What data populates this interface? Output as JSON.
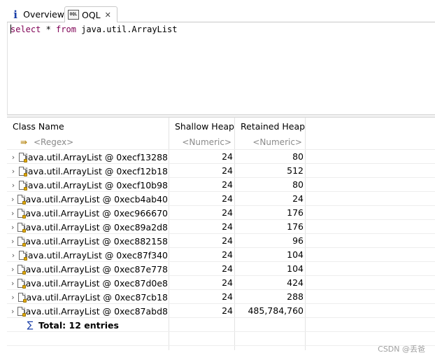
{
  "tabs": [
    {
      "label": "Overview",
      "icon": "info-icon"
    },
    {
      "label": "OQL",
      "icon": "oql-icon",
      "active": true
    }
  ],
  "editor": {
    "keyword_select": "select",
    "mid1": " * ",
    "keyword_from": "from",
    "mid2": " java.util.ArrayList"
  },
  "table": {
    "columns": [
      "Class Name",
      "Shallow Heap",
      "Retained Heap"
    ],
    "filters": [
      "<Regex>",
      "<Numeric>",
      "<Numeric>"
    ],
    "rows": [
      {
        "name": "java.util.ArrayList @ 0xecf13288",
        "shallow": "24",
        "retained": "80"
      },
      {
        "name": "java.util.ArrayList @ 0xecf12b18",
        "shallow": "24",
        "retained": "512"
      },
      {
        "name": "java.util.ArrayList @ 0xecf10b98",
        "shallow": "24",
        "retained": "80"
      },
      {
        "name": "java.util.ArrayList @ 0xecb4ab40",
        "shallow": "24",
        "retained": "24"
      },
      {
        "name": "java.util.ArrayList @ 0xec966670",
        "shallow": "24",
        "retained": "176"
      },
      {
        "name": "java.util.ArrayList @ 0xec89a2d8",
        "shallow": "24",
        "retained": "176"
      },
      {
        "name": "java.util.ArrayList @ 0xec882158",
        "shallow": "24",
        "retained": "96"
      },
      {
        "name": "java.util.ArrayList @ 0xec87f340",
        "shallow": "24",
        "retained": "104"
      },
      {
        "name": "java.util.ArrayList @ 0xec87e778",
        "shallow": "24",
        "retained": "104"
      },
      {
        "name": "java.util.ArrayList @ 0xec87d0e8",
        "shallow": "24",
        "retained": "424"
      },
      {
        "name": "java.util.ArrayList @ 0xec87cb18",
        "shallow": "24",
        "retained": "288"
      },
      {
        "name": "java.util.ArrayList @ 0xec87abd8",
        "shallow": "24",
        "retained": "485,784,760"
      }
    ],
    "total": "Total: 12 entries"
  },
  "watermark": "CSDN @丢爸",
  "colors": {
    "keyword": "#7f0055",
    "info_icon": "#1a3fa8"
  }
}
